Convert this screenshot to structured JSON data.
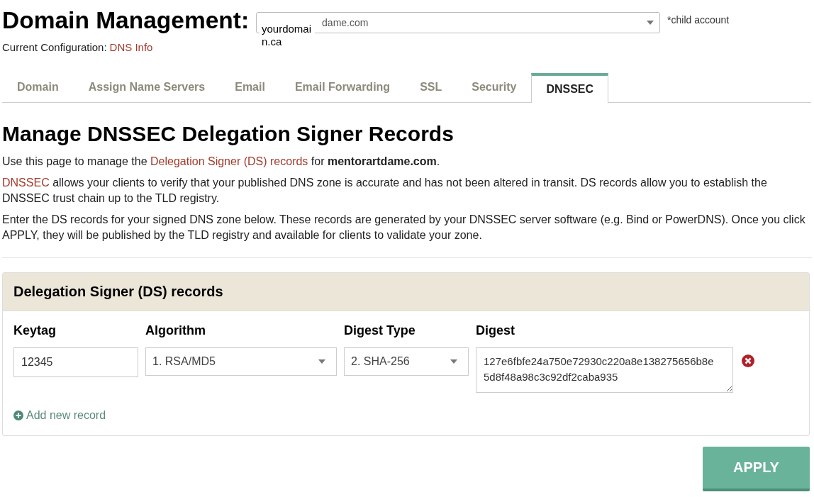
{
  "header": {
    "title": "Domain Management:",
    "domain_select": {
      "value": "dame.com"
    },
    "overlay_text": "yourdomain.ca",
    "note": "*child account",
    "config_label": "Current Configuration:",
    "config_link": "DNS Info"
  },
  "tabs": [
    {
      "label": "Domain",
      "selected": false
    },
    {
      "label": "Assign Name Servers",
      "selected": false
    },
    {
      "label": "Email",
      "selected": false
    },
    {
      "label": "Email Forwarding",
      "selected": false
    },
    {
      "label": "SSL",
      "selected": false
    },
    {
      "label": "Security",
      "selected": false
    },
    {
      "label": "DNSSEC",
      "selected": true
    }
  ],
  "heading": "Manage DNSSEC Delegation Signer Records",
  "intro": {
    "before": "Use this page to manage the ",
    "link": "Delegation Signer (DS) records",
    "after": " for **mentorartdame.com**."
  },
  "about": {
    "link": "DNSSEC",
    "text": " allows your clients to verify that your published DNS zone is accurate and has not been altered in transit. DS records allow you to establish the DNSSEC trust chain up to the TLD registry."
  },
  "instructions": "Enter the DS records for your signed DNS zone below. These records are generated by your DNSSEC server software (e.g. Bind or PowerDNS). Once you click APPLY, they will be published by the TLD registry and available for clients to validate your zone.",
  "panel": {
    "title": "Delegation Signer (DS) records",
    "columns": [
      "Keytag",
      "Algorithm",
      "Digest Type",
      "Digest"
    ],
    "records": [
      {
        "keytag": "12345",
        "algorithm": "1. RSA/MD5",
        "digest_type": "2. SHA-256",
        "digest": "127e6fbfe24a750e72930c220a8e138275656b8e5d8f48a98c3c92df2caba935"
      }
    ],
    "add_link": "Add new record"
  },
  "apply_button": "APPLY"
}
